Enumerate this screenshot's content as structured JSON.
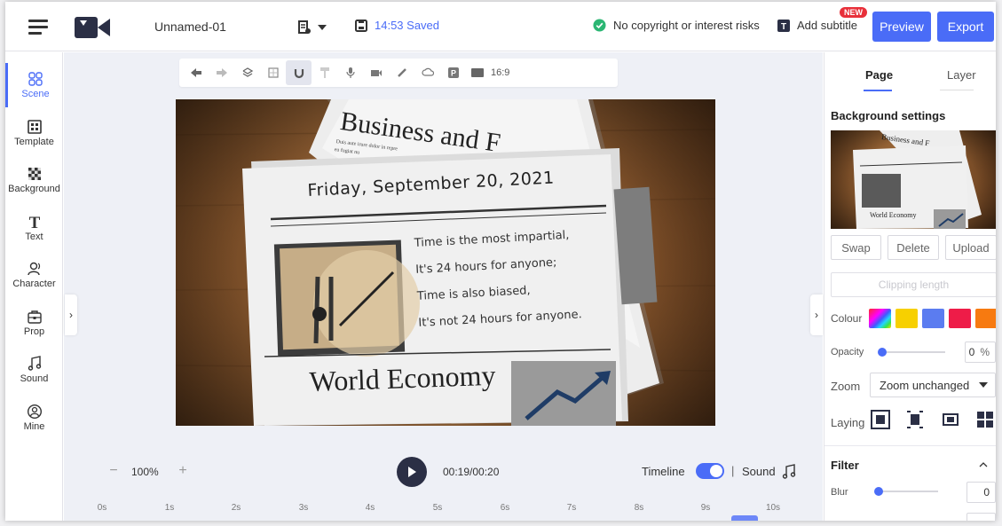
{
  "header": {
    "project_name": "Unnamed-01",
    "saved_text": "14:53 Saved",
    "copyright_text": "No copyright or interest risks",
    "add_subtitle": "Add subtitle",
    "new_badge": "NEW",
    "preview": "Preview",
    "export": "Export"
  },
  "sidebar": {
    "items": [
      {
        "label": "Scene",
        "icon": "scene-icon"
      },
      {
        "label": "Template",
        "icon": "template-icon"
      },
      {
        "label": "Background",
        "icon": "background-icon"
      },
      {
        "label": "Text",
        "icon": "text-icon"
      },
      {
        "label": "Character",
        "icon": "character-icon"
      },
      {
        "label": "Prop",
        "icon": "prop-icon"
      },
      {
        "label": "Sound",
        "icon": "sound-icon"
      },
      {
        "label": "Mine",
        "icon": "mine-icon"
      }
    ]
  },
  "toolbar": {
    "ratio": "16:9",
    "tools": [
      "undo",
      "redo",
      "layers",
      "grid",
      "magnet",
      "paint-roller",
      "microphone",
      "camera",
      "pen",
      "cloud",
      "parking",
      "aspect"
    ]
  },
  "stage": {
    "headline": "Business and F",
    "date": "Friday, September 20, 2021",
    "poem": [
      "Time is the most impartial,",
      "It's 24 hours for anyone;",
      "Time is also biased,",
      "It's not 24 hours for anyone."
    ],
    "footer_headline": "World Economy",
    "lorem": "Duis aute irure dolor in repre",
    "lorem2": "eu fugiat nu"
  },
  "playback": {
    "zoom": "100%",
    "timecode": "00:19/00:20",
    "timeline_label": "Timeline",
    "sep": "|",
    "sound_label": "Sound",
    "timeline_on": true
  },
  "ruler": [
    "0s",
    "1s",
    "2s",
    "3s",
    "4s",
    "5s",
    "6s",
    "7s",
    "8s",
    "9s",
    "10s"
  ],
  "panel": {
    "tab_page": "Page",
    "tab_layer": "Layer",
    "bg_settings": "Background settings",
    "thumb_headline": "Business and F",
    "thumb_footer": "World Economy",
    "swap": "Swap",
    "delete": "Delete",
    "upload": "Upload",
    "clipping": "Clipping length",
    "colour_label": "Colour",
    "colours": [
      "#f7d000",
      "#5b7cf0",
      "#ee1c48",
      "#f77a10"
    ],
    "opacity_label": "Opacity",
    "opacity_value": "0",
    "opacity_unit": "%",
    "zoom_label": "Zoom",
    "zoom_value": "Zoom unchanged",
    "laying_label": "Laying",
    "filter_title": "Filter",
    "blur_label": "Blur",
    "blur_value": "0"
  }
}
